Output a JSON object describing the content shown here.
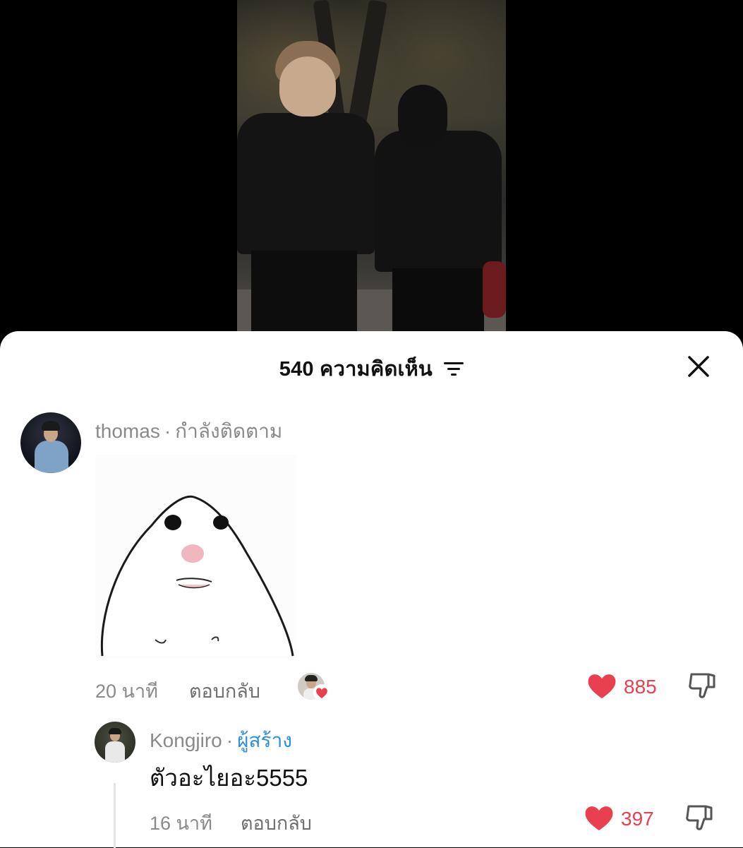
{
  "video": {
    "description_icon": "video-frame"
  },
  "sheet": {
    "header_title": "540 ความคิดเห็น",
    "filter_icon": "filter-icon",
    "close_icon": "close-icon"
  },
  "comments": [
    {
      "username": "thomas",
      "separator": "·",
      "status": "กำลังติดตาม",
      "sticker": "sticker-image",
      "time": "20 นาที",
      "reply_label": "ตอบกลับ",
      "like_count": "885",
      "accent": "#e8404f",
      "replies": [
        {
          "username": "Kongjiro",
          "separator": "·",
          "role": "ผู้สร้าง",
          "text": "ตัวอะไยอะ5555",
          "time": "16 นาที",
          "reply_label": "ตอบกลับ",
          "like_count": "397",
          "role_color": "#2e8fd9"
        }
      ]
    }
  ]
}
